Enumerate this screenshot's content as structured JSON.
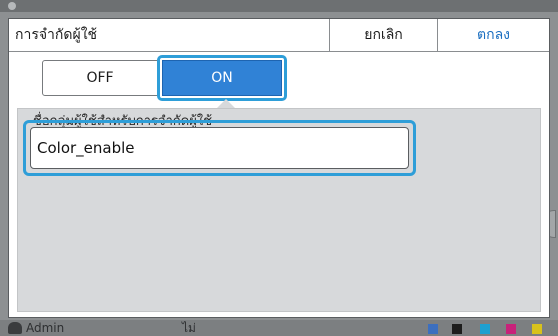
{
  "dialog": {
    "title": "การจำกัดผู้ใช้",
    "cancel_label": "ยกเลิก",
    "ok_label": "ตกลง"
  },
  "toggle": {
    "off_label": "OFF",
    "on_label": "ON",
    "selected": "ON"
  },
  "panel": {
    "label": "ชื่อกลุ่มผู้ใช้สำหรับการจำกัดผู้ใช้",
    "input_value": "Color_enable"
  },
  "background": {
    "status_user": "Admin",
    "status_mode": "ไม่"
  },
  "colors": {
    "accent": "#2e9ed8",
    "on_button": "#3082d6",
    "ok_text": "#1a6ec0",
    "panel": "#d7d9db",
    "backdrop": "#8d9092"
  }
}
